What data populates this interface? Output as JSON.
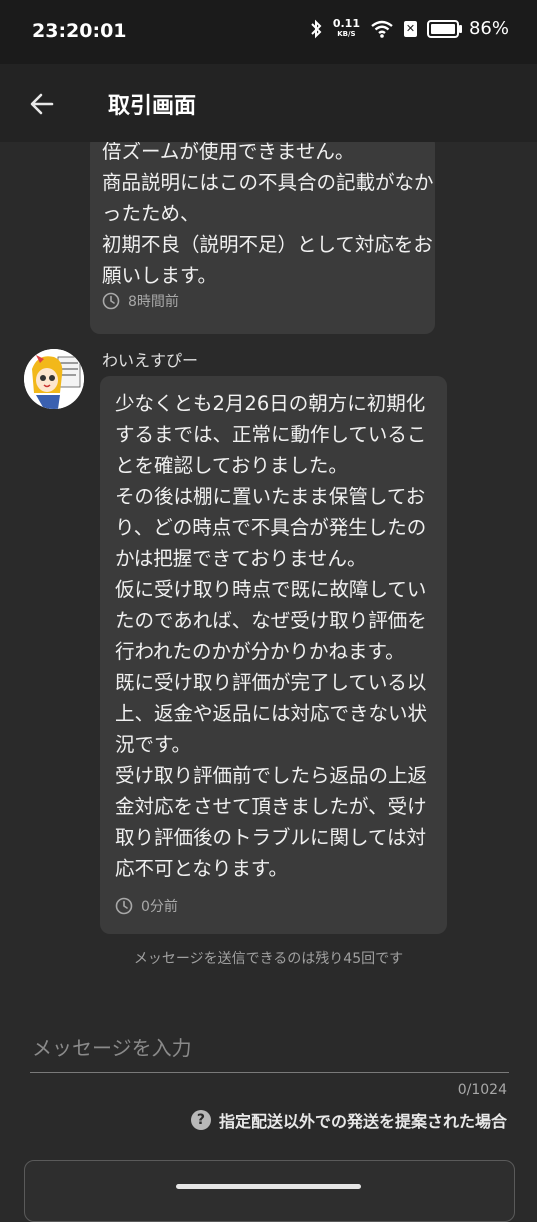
{
  "status_bar": {
    "time": "23:20:01",
    "net_speed_value": "0.11",
    "net_speed_unit": "KB/S",
    "battery": "86%",
    "battery_level": 0.86
  },
  "header": {
    "title": "取引画面"
  },
  "messages": [
    {
      "text": "倍ズームが使用できません。\n商品説明にはこの不具合の記載がなかったため、\n初期不良（説明不足）として対応をお願いします。",
      "time": "8時間前"
    },
    {
      "sender": "わいえすぴー",
      "text": "少なくとも2月26日の朝方に初期化するまでは、正常に動作していることを確認しておりました。\nその後は棚に置いたまま保管しており、どの時点で不具合が発生したのかは把握できておりません。\n仮に受け取り時点で既に故障していたのであれば、なぜ受け取り評価を行われたのかが分かりかねます。\n既に受け取り評価が完了している以上、返金や返品には対応できない状況です。\n受け取り評価前でしたら返品の上返金対応をさせて頂きましたが、受け取り評価後のトラブルに関しては対応不可となります。",
      "time": "0分前"
    }
  ],
  "remaining_notice": "メッセージを送信できるのは残り45回です",
  "composer": {
    "placeholder": "メッセージを入力",
    "counter": "0/1024",
    "help_link": "指定配送以外での発送を提案された場合"
  },
  "colors": {
    "background": "#2a2a2a",
    "bubble": "#3b3b3b",
    "header": "#232323"
  }
}
